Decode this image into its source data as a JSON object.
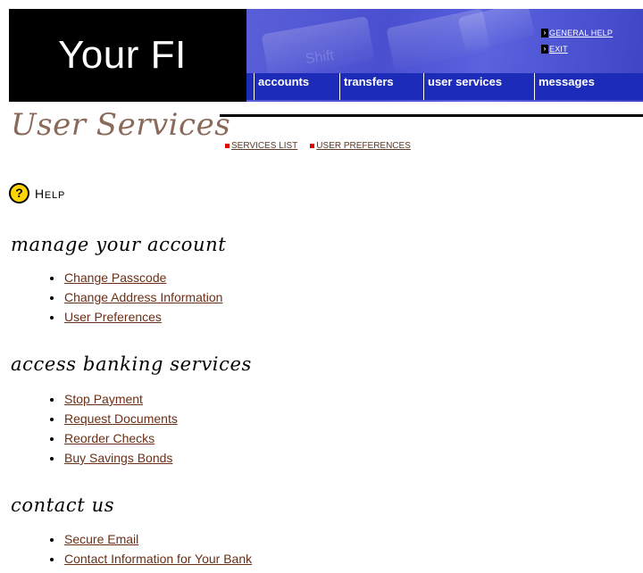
{
  "header": {
    "brand": "Your FI",
    "banner_watermark": "Shift",
    "utility_links": [
      {
        "label": "General Help"
      },
      {
        "label": "Exit"
      }
    ],
    "nav": [
      {
        "label": "accounts"
      },
      {
        "label": "transfers"
      },
      {
        "label": "user services"
      },
      {
        "label": "messages"
      }
    ]
  },
  "page": {
    "title": "User Services",
    "subnav": [
      {
        "label": "Services List"
      },
      {
        "label": "User Preferences"
      }
    ],
    "help_label": "Help"
  },
  "sections": [
    {
      "heading": "manage your account",
      "links": [
        "Change Passcode",
        "Change Address Information",
        "User Preferences"
      ]
    },
    {
      "heading": "access banking services",
      "links": [
        "Stop Payment",
        "Request Documents",
        "Reorder Checks",
        "Buy Savings Bonds"
      ]
    },
    {
      "heading": "contact us",
      "links": [
        "Secure Email",
        "Contact Information for Your Bank"
      ]
    }
  ],
  "colors": {
    "header_black": "#000000",
    "banner_blue": "#4a4fd0",
    "nav_blue": "#1c2bb8",
    "title_brown": "#8a6a5a",
    "link_brown": "#6b2f16",
    "help_yellow": "#ffd400",
    "subnav_marker_red": "#e00000"
  },
  "icons": {
    "utility_arrow": "arrow-right-icon",
    "help": "question-mark-icon",
    "subnav_marker": "red-square-icon",
    "list_bullet": "bullet-icon"
  }
}
